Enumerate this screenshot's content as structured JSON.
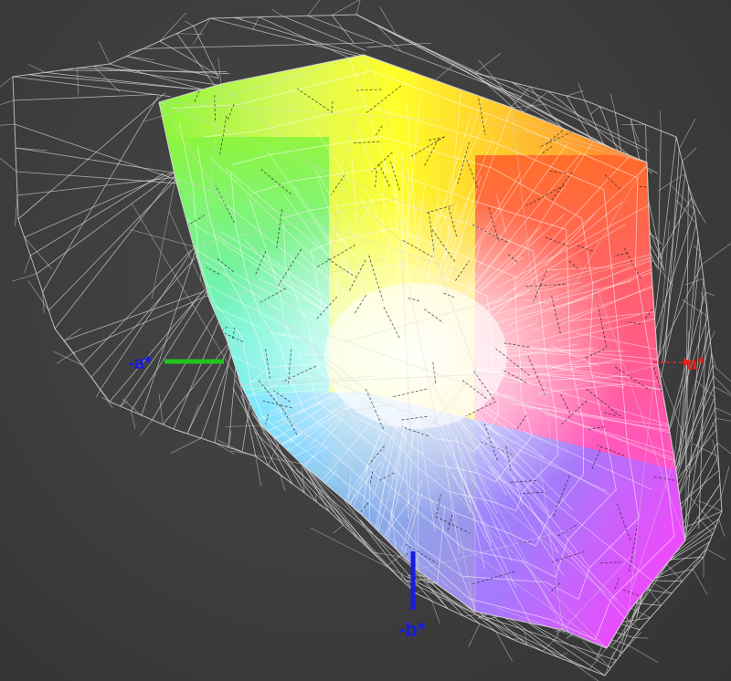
{
  "axes": {
    "pos_a_label": "a*",
    "neg_a_label": "-a*",
    "neg_b_label": "-b*",
    "pos_a_color": "#e0231b",
    "neg_a_color": "#22c41e",
    "neg_b_color": "#1a1ae6"
  },
  "colors": {
    "background": "#3c3c3c",
    "wireframe": "#d6d6d6",
    "inner_dashes": "#222222"
  }
}
